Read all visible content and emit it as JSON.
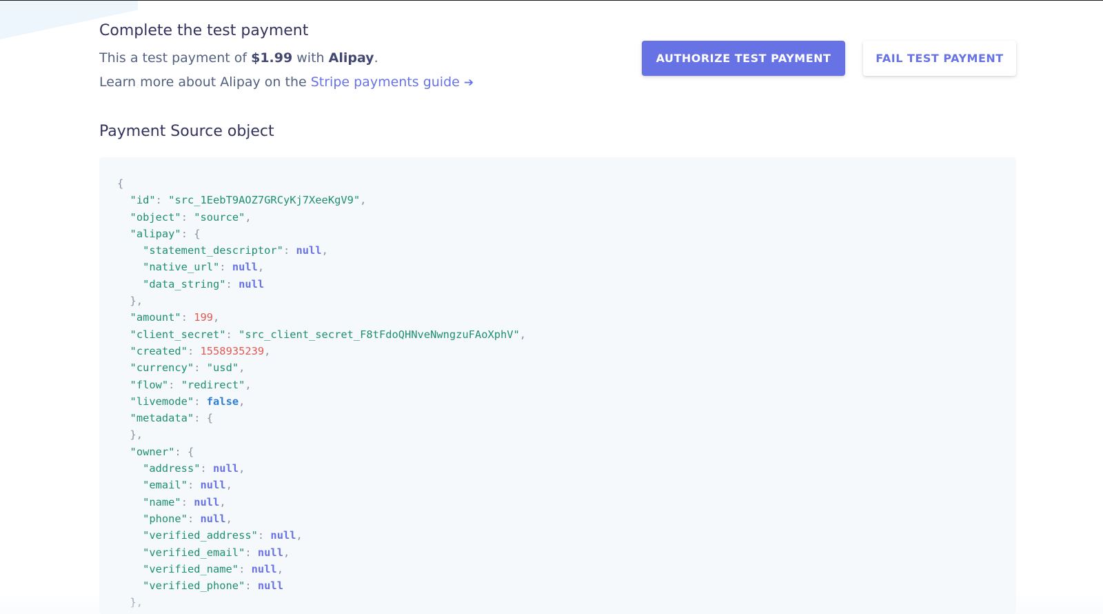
{
  "header": {
    "title": "Complete the test payment",
    "description_prefix": "This a test payment of ",
    "amount": "$1.99",
    "description_middle": " with ",
    "method": "Alipay",
    "description_suffix": ".",
    "learn_prefix": "Learn more about Alipay on the ",
    "learn_link": "Stripe payments guide",
    "learn_arrow": "➔"
  },
  "actions": {
    "authorize_label": "AUTHORIZE TEST PAYMENT",
    "fail_label": "FAIL TEST PAYMENT"
  },
  "source": {
    "heading": "Payment Source object",
    "id": "\"src_1EebT9AOZ7GRCyKj7XeeKgV9\"",
    "object": "\"source\"",
    "amount": "199",
    "client_secret": "\"src_client_secret_F8tFdoQHNveNwngzuFAoXphV\"",
    "created": "1558935239",
    "currency": "\"usd\"",
    "flow": "\"redirect\"",
    "livemode": "false",
    "null_value": "null"
  },
  "colors": {
    "accent": "#6772e5",
    "key_green": "#1d8f6f",
    "number_red": "#e25950",
    "bool_blue": "#2d7fd6",
    "code_bg": "#f6f9fc"
  },
  "icons": {
    "arrow": "arrow-right-icon"
  }
}
